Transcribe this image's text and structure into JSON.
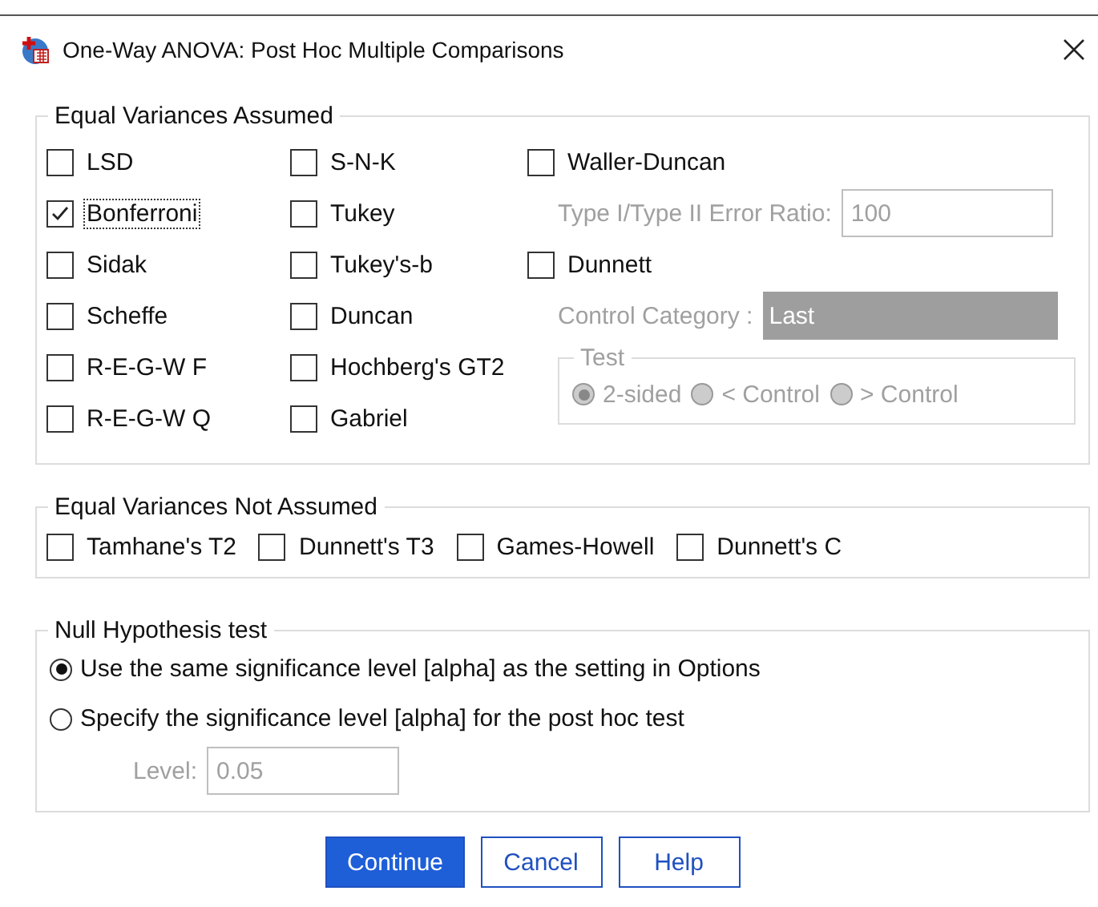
{
  "window": {
    "title": "One-Way ANOVA: Post Hoc Multiple Comparisons"
  },
  "equal_variances_assumed": {
    "title": "Equal Variances Assumed",
    "columns": [
      [
        {
          "label": "LSD",
          "checked": false,
          "focused": false
        },
        {
          "label": "Bonferroni",
          "checked": true,
          "focused": true
        },
        {
          "label": "Sidak",
          "checked": false,
          "focused": false
        },
        {
          "label": "Scheffe",
          "checked": false,
          "focused": false
        },
        {
          "label": "R-E-G-W F",
          "checked": false,
          "focused": false
        },
        {
          "label": "R-E-G-W Q",
          "checked": false,
          "focused": false
        }
      ],
      [
        {
          "label": "S-N-K",
          "checked": false,
          "focused": false
        },
        {
          "label": "Tukey",
          "checked": false,
          "focused": false
        },
        {
          "label": "Tukey's-b",
          "checked": false,
          "focused": false
        },
        {
          "label": "Duncan",
          "checked": false,
          "focused": false
        },
        {
          "label": "Hochberg's GT2",
          "checked": false,
          "focused": false
        },
        {
          "label": "Gabriel",
          "checked": false,
          "focused": false
        }
      ]
    ],
    "waller_duncan": {
      "label": "Waller-Duncan",
      "checked": false
    },
    "error_ratio": {
      "label": "Type I/Type II Error Ratio:",
      "value": "100",
      "disabled": true
    },
    "dunnett": {
      "label": "Dunnett",
      "checked": false
    },
    "control_category": {
      "label": "Control Category :",
      "value": "Last",
      "disabled": true
    },
    "test": {
      "title": "Test",
      "disabled": true,
      "options": [
        {
          "label": "2-sided",
          "selected": true
        },
        {
          "label": "< Control",
          "selected": false
        },
        {
          "label": "> Control",
          "selected": false
        }
      ]
    }
  },
  "equal_variances_not_assumed": {
    "title": "Equal Variances Not Assumed",
    "options": [
      {
        "label": "Tamhane's T2",
        "checked": false
      },
      {
        "label": "Dunnett's T3",
        "checked": false
      },
      {
        "label": "Games-Howell",
        "checked": false
      },
      {
        "label": "Dunnett's C",
        "checked": false
      }
    ]
  },
  "null_hypothesis_test": {
    "title": "Null Hypothesis test",
    "options": [
      {
        "label": "Use the same significance level [alpha] as the setting in Options",
        "selected": true
      },
      {
        "label": "Specify the significance level [alpha] for the post hoc test",
        "selected": false
      }
    ],
    "level": {
      "label": "Level:",
      "value": "0.05",
      "disabled": true
    }
  },
  "buttons": [
    {
      "label": "Continue",
      "default": true
    },
    {
      "label": "Cancel",
      "default": false
    },
    {
      "label": "Help",
      "default": false
    }
  ]
}
